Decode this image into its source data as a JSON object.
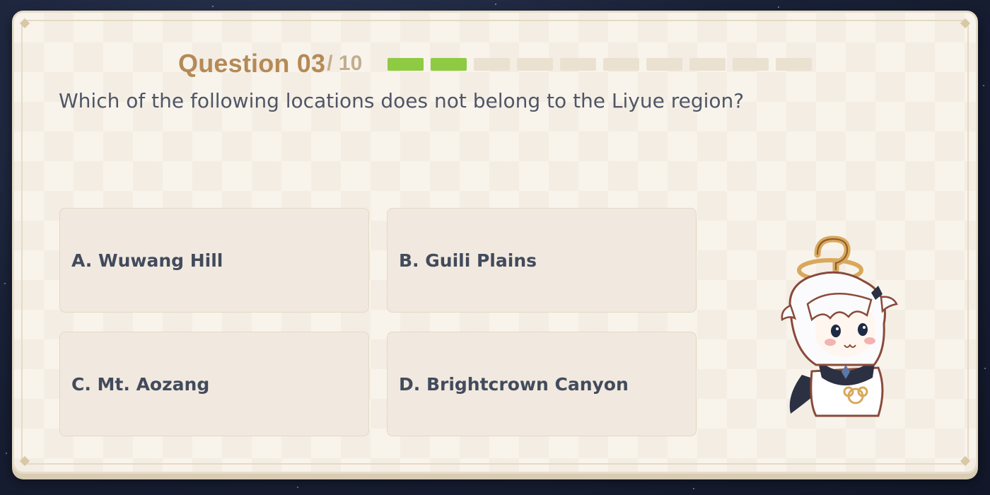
{
  "quiz": {
    "question_label": "Question 03",
    "question_total": "/ 10",
    "progress": {
      "completed": 2,
      "total": 10
    },
    "question_text": "Which of the following locations does not belong to the Liyue region?",
    "options": [
      {
        "id": "A",
        "label": "A. Wuwang Hill"
      },
      {
        "id": "B",
        "label": "B. Guili Plains"
      },
      {
        "id": "C",
        "label": "C. Mt. Aozang"
      },
      {
        "id": "D",
        "label": "D. Brightcrown Canyon"
      }
    ]
  },
  "colors": {
    "accent_title": "#b58a56",
    "progress_done": "#8fca43",
    "progress_pending": "#ebe1d1",
    "option_bg": "#f1e9df",
    "text_dark": "#424b5d"
  },
  "icons": {
    "mascot": "paimon-chibi-mascot-icon"
  }
}
